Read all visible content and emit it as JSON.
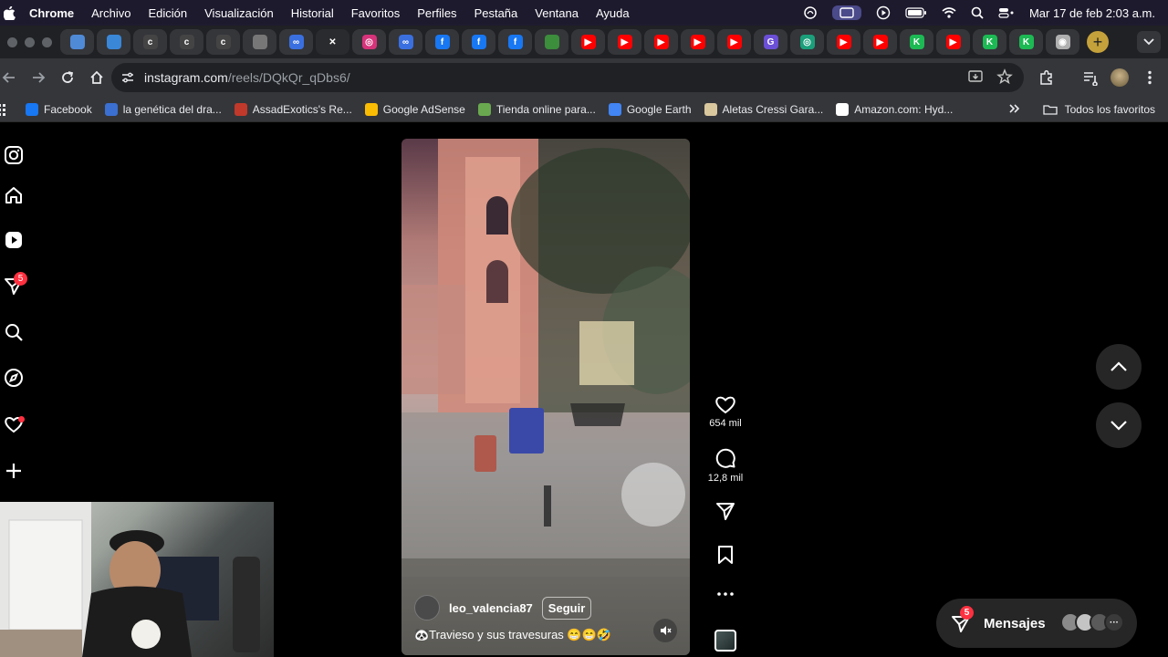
{
  "menubar": {
    "app": "Chrome",
    "items": [
      "Archivo",
      "Edición",
      "Visualización",
      "Historial",
      "Favoritos",
      "Perfiles",
      "Pestaña",
      "Ventana",
      "Ayuda"
    ],
    "datetime": "Mar 17 de feb  2:03 a.m."
  },
  "tabs": {
    "favicons": [
      {
        "icon": "cloud-icon",
        "color": "#4f8ad6",
        "text": ""
      },
      {
        "icon": "cloud-icon",
        "color": "#3a87d8",
        "text": ""
      },
      {
        "icon": "c-icon",
        "color": "#444444",
        "text": "c"
      },
      {
        "icon": "c-icon",
        "color": "#444444",
        "text": "c"
      },
      {
        "icon": "c-icon",
        "color": "#444444",
        "text": "c"
      },
      {
        "icon": "blank-icon",
        "color": "#777777",
        "text": ""
      },
      {
        "icon": "meta-icon",
        "color": "#3a6fe0",
        "text": "∞"
      },
      {
        "icon": "close-icon",
        "color": "#2a2b2e",
        "text": "✕",
        "active": true
      },
      {
        "icon": "instagram-icon",
        "color": "#d6337a",
        "text": "◎"
      },
      {
        "icon": "meta-icon",
        "color": "#3a6fe0",
        "text": "∞"
      },
      {
        "icon": "facebook-icon",
        "color": "#1877f2",
        "text": "f"
      },
      {
        "icon": "facebook-icon",
        "color": "#1877f2",
        "text": "f"
      },
      {
        "icon": "facebook-icon",
        "color": "#1877f2",
        "text": "f"
      },
      {
        "icon": "green-icon",
        "color": "#3c8d3c",
        "text": ""
      },
      {
        "icon": "youtube-icon",
        "color": "#ff0000",
        "text": "▶"
      },
      {
        "icon": "youtube-icon",
        "color": "#ff0000",
        "text": "▶"
      },
      {
        "icon": "youtube-icon",
        "color": "#ff0000",
        "text": "▶"
      },
      {
        "icon": "youtube-icon",
        "color": "#ff0000",
        "text": "▶"
      },
      {
        "icon": "youtube-icon",
        "color": "#ff0000",
        "text": "▶"
      },
      {
        "icon": "g-icon",
        "color": "#6b4fd6",
        "text": "G"
      },
      {
        "icon": "chatgpt-icon",
        "color": "#1a9f7a",
        "text": "◎"
      },
      {
        "icon": "youtube-icon",
        "color": "#ff0000",
        "text": "▶"
      },
      {
        "icon": "youtube-icon",
        "color": "#ff0000",
        "text": "▶"
      },
      {
        "icon": "k-icon",
        "color": "#1db954",
        "text": "K"
      },
      {
        "icon": "youtube-icon",
        "color": "#ff0000",
        "text": "▶"
      },
      {
        "icon": "k-icon",
        "color": "#1db954",
        "text": "K"
      },
      {
        "icon": "k-icon",
        "color": "#1db954",
        "text": "K"
      },
      {
        "icon": "chrome-icon",
        "color": "#b0b0b0",
        "text": "◉"
      }
    ]
  },
  "toolbar": {
    "url_host": "instagram.com",
    "url_path": "/reels/DQkQr_qDbs6/"
  },
  "bookmarks": {
    "items": [
      {
        "label": "Facebook",
        "color": "#1877f2"
      },
      {
        "label": "la genética del dra...",
        "color": "#3b6fd1"
      },
      {
        "label": "AssadExotics's Re...",
        "color": "#c0392b"
      },
      {
        "label": "Google AdSense",
        "color": "#fbbc04"
      },
      {
        "label": "Tienda online para...",
        "color": "#6aa84f"
      },
      {
        "label": "Google Earth",
        "color": "#4285f4"
      },
      {
        "label": "Aletas Cressi Gara...",
        "color": "#d9c79e"
      },
      {
        "label": "Amazon.com: Hyd...",
        "color": "#ffffff"
      }
    ],
    "all_label": "Todos los favoritos"
  },
  "sidebar": {
    "notifications_badge": "5"
  },
  "reel": {
    "username": "leo_valencia87",
    "follow_label": "Seguir",
    "caption": "🐼Travieso y sus travesuras 😁😁🤣"
  },
  "actions": {
    "likes": "654 mil",
    "comments": "12,8 mil"
  },
  "messages": {
    "label": "Mensajes",
    "badge": "5"
  }
}
